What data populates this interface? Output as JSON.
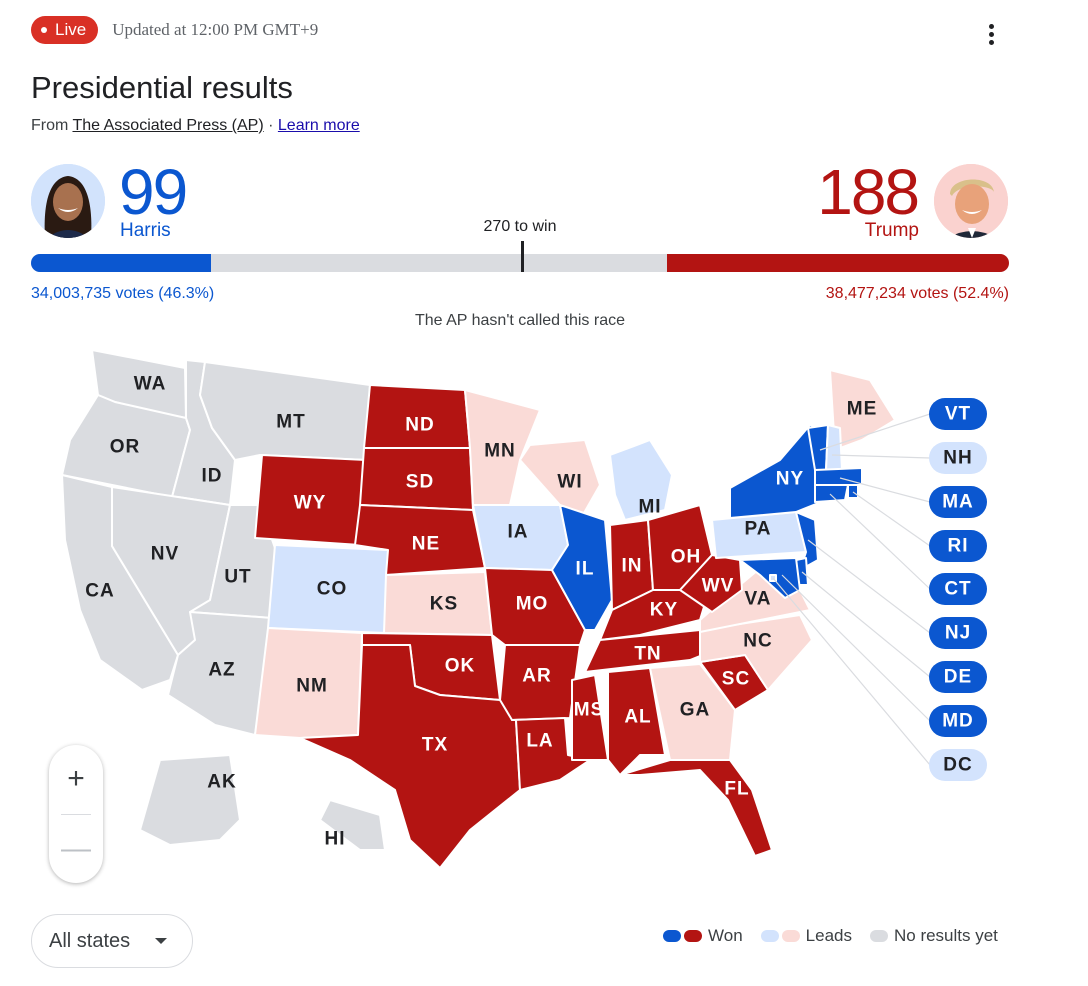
{
  "header": {
    "live_label": "Live",
    "updated": "Updated at 12:00 PM GMT+9",
    "title": "Presidential results",
    "source_prefix": "From ",
    "source_link": "The Associated Press (AP)",
    "separator": " · ",
    "learn_more": "Learn more"
  },
  "colors": {
    "dem_won": "#0b57d0",
    "rep_won": "#b31412",
    "dem_leads": "#d3e3fd",
    "rep_leads": "#fadbd7",
    "no_results": "#dadce0",
    "live": "#d93025"
  },
  "candidates": {
    "harris": {
      "name": "Harris",
      "electoral_votes": "99",
      "votes_text": "34,003,735 votes (46.3%)",
      "popular_votes": 34003735,
      "vote_pct": 46.3
    },
    "trump": {
      "name": "Trump",
      "electoral_votes": "188",
      "votes_text": "38,477,234 votes (52.4%)",
      "popular_votes": 38477234,
      "vote_pct": 52.4
    }
  },
  "race": {
    "to_win_label": "270 to win",
    "to_win": 270,
    "total_ev": 538,
    "status": "The AP hasn't called this race"
  },
  "map": {
    "states": [
      {
        "abbr": "WA",
        "status": "none"
      },
      {
        "abbr": "OR",
        "status": "none"
      },
      {
        "abbr": "CA",
        "status": "none"
      },
      {
        "abbr": "ID",
        "status": "none"
      },
      {
        "abbr": "NV",
        "status": "none"
      },
      {
        "abbr": "MT",
        "status": "none"
      },
      {
        "abbr": "UT",
        "status": "none"
      },
      {
        "abbr": "AZ",
        "status": "none"
      },
      {
        "abbr": "WY",
        "status": "rep_won"
      },
      {
        "abbr": "CO",
        "status": "dem_leads"
      },
      {
        "abbr": "NM",
        "status": "rep_leads"
      },
      {
        "abbr": "ND",
        "status": "rep_won"
      },
      {
        "abbr": "SD",
        "status": "rep_won"
      },
      {
        "abbr": "NE",
        "status": "rep_won"
      },
      {
        "abbr": "KS",
        "status": "rep_leads"
      },
      {
        "abbr": "OK",
        "status": "rep_won"
      },
      {
        "abbr": "TX",
        "status": "rep_won"
      },
      {
        "abbr": "MN",
        "status": "rep_leads"
      },
      {
        "abbr": "IA",
        "status": "dem_leads"
      },
      {
        "abbr": "MO",
        "status": "rep_won"
      },
      {
        "abbr": "AR",
        "status": "rep_won"
      },
      {
        "abbr": "LA",
        "status": "rep_won"
      },
      {
        "abbr": "WI",
        "status": "rep_leads"
      },
      {
        "abbr": "IL",
        "status": "dem_won"
      },
      {
        "abbr": "MI",
        "status": "dem_leads"
      },
      {
        "abbr": "IN",
        "status": "rep_won"
      },
      {
        "abbr": "OH",
        "status": "rep_won"
      },
      {
        "abbr": "KY",
        "status": "rep_won"
      },
      {
        "abbr": "TN",
        "status": "rep_won"
      },
      {
        "abbr": "MS",
        "status": "rep_won"
      },
      {
        "abbr": "AL",
        "status": "rep_won"
      },
      {
        "abbr": "GA",
        "status": "rep_leads"
      },
      {
        "abbr": "FL",
        "status": "rep_won"
      },
      {
        "abbr": "SC",
        "status": "rep_won"
      },
      {
        "abbr": "NC",
        "status": "rep_leads"
      },
      {
        "abbr": "VA",
        "status": "rep_leads"
      },
      {
        "abbr": "WV",
        "status": "rep_won"
      },
      {
        "abbr": "PA",
        "status": "dem_leads"
      },
      {
        "abbr": "NY",
        "status": "dem_won"
      },
      {
        "abbr": "ME",
        "status": "rep_leads"
      },
      {
        "abbr": "AK",
        "status": "none"
      },
      {
        "abbr": "HI",
        "status": "none"
      }
    ],
    "small_states": [
      {
        "abbr": "VT",
        "status": "dem_won"
      },
      {
        "abbr": "NH",
        "status": "dem_leads"
      },
      {
        "abbr": "MA",
        "status": "dem_won"
      },
      {
        "abbr": "RI",
        "status": "dem_won"
      },
      {
        "abbr": "CT",
        "status": "dem_won"
      },
      {
        "abbr": "NJ",
        "status": "dem_won"
      },
      {
        "abbr": "DE",
        "status": "dem_won"
      },
      {
        "abbr": "MD",
        "status": "dem_won"
      },
      {
        "abbr": "DC",
        "status": "dem_leads"
      }
    ]
  },
  "controls": {
    "zoom_in": "+",
    "zoom_out": "—",
    "state_filter": "All states"
  },
  "legend": {
    "won": "Won",
    "leads": "Leads",
    "no_results": "No results yet"
  }
}
